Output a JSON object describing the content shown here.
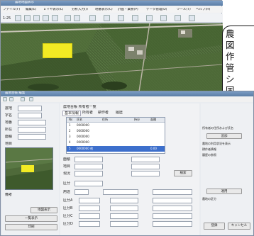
{
  "main_window": {
    "title": "農地地図表示",
    "menu": [
      "ファイル(F)",
      "編集(E)",
      "レイヤ表示(L)",
      "分析入力(I)",
      "地番表示(C)",
      "計画・業務(P)",
      "データ管理(D)",
      "ツール(T)",
      "ヘルプ(H)"
    ],
    "toolbar_scale_label": "1:25"
  },
  "callout": {
    "lines": [
      "農",
      "図",
      "作",
      "管",
      "シ",
      "国",
      "氏"
    ]
  },
  "sub_window": {
    "title": "農地台帳 編集",
    "labels": {
      "field1": "農地",
      "field2": "字名",
      "field3": "地番",
      "field4": "所在",
      "field5": "面積",
      "field6": "地目",
      "field7": "備考"
    },
    "header_text": "農地台帳 所有者一覧",
    "tabs": [
      "基本情報",
      "所有者",
      "耕作者",
      "履歴"
    ],
    "grid_headers": [
      "No",
      "氏名",
      "住所",
      "持分",
      "面積"
    ],
    "grid_rows": [
      {
        "no": "1",
        "name": "0000000",
        "val": ""
      },
      {
        "no": "2",
        "name": "0000000",
        "val": ""
      },
      {
        "no": "3",
        "name": "0000000",
        "val": ""
      },
      {
        "no": "4",
        "name": "0000000",
        "val": ""
      },
      {
        "no": "5",
        "name": "0000000 他",
        "val": "0.00"
      }
    ],
    "form_labels": [
      "面積",
      "地目",
      "現況",
      "区分",
      "用途"
    ],
    "bottom_labels": [
      "区分A",
      "区分B",
      "区分C",
      "区分D"
    ],
    "buttons": {
      "search": "検索",
      "apply": "適用",
      "register": "登録",
      "cancel": "キャンセル",
      "add": "追加",
      "map_button": "地図表示",
      "list_button": "一覧表示",
      "print_button": "印刷"
    },
    "right_panel_texts": [
      "所有者の住所および氏名",
      "農地の利用状況を表示",
      "耕作者情報",
      "履歴の参照",
      "農地の区分"
    ]
  },
  "colors": {
    "titlebar": "#5b7ea6",
    "highlight_field": "#f2ea24",
    "selection": "#3d6fcc"
  }
}
